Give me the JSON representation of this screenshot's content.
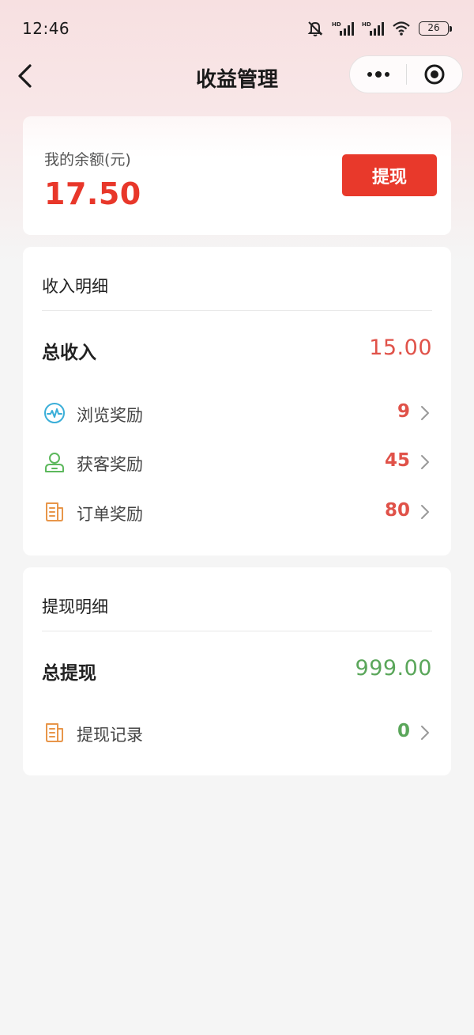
{
  "status_bar": {
    "time": "12:46",
    "battery": "26",
    "icons": [
      "mute-icon",
      "signal-icon",
      "signal-icon",
      "wifi-icon",
      "battery-icon"
    ]
  },
  "nav": {
    "title": "收益管理",
    "back_icon": "chevron-left-icon",
    "more_icon": "more-dots-icon",
    "close_icon": "target-circle-icon"
  },
  "balance": {
    "label": "我的余额(元)",
    "value": "17.50",
    "withdraw_button": "提现"
  },
  "income": {
    "section_title": "收入明细",
    "total_label": "总收入",
    "total_value": "15.00",
    "items": [
      {
        "label": "浏览奖励",
        "value": "9",
        "icon": "pulse-icon"
      },
      {
        "label": "获客奖励",
        "value": "45",
        "icon": "user-icon"
      },
      {
        "label": "订单奖励",
        "value": "80",
        "icon": "document-icon"
      }
    ]
  },
  "withdraw": {
    "section_title": "提现明细",
    "total_label": "总提现",
    "total_value": "999.00",
    "items": [
      {
        "label": "提现记录",
        "value": "0",
        "icon": "document-icon"
      }
    ]
  },
  "colors": {
    "accent_red": "#e8392b",
    "value_red": "#e05249",
    "value_green": "#5aa65a",
    "icon_blue": "#3aaed8",
    "icon_green": "#5cb85c",
    "icon_orange": "#e8964a"
  }
}
